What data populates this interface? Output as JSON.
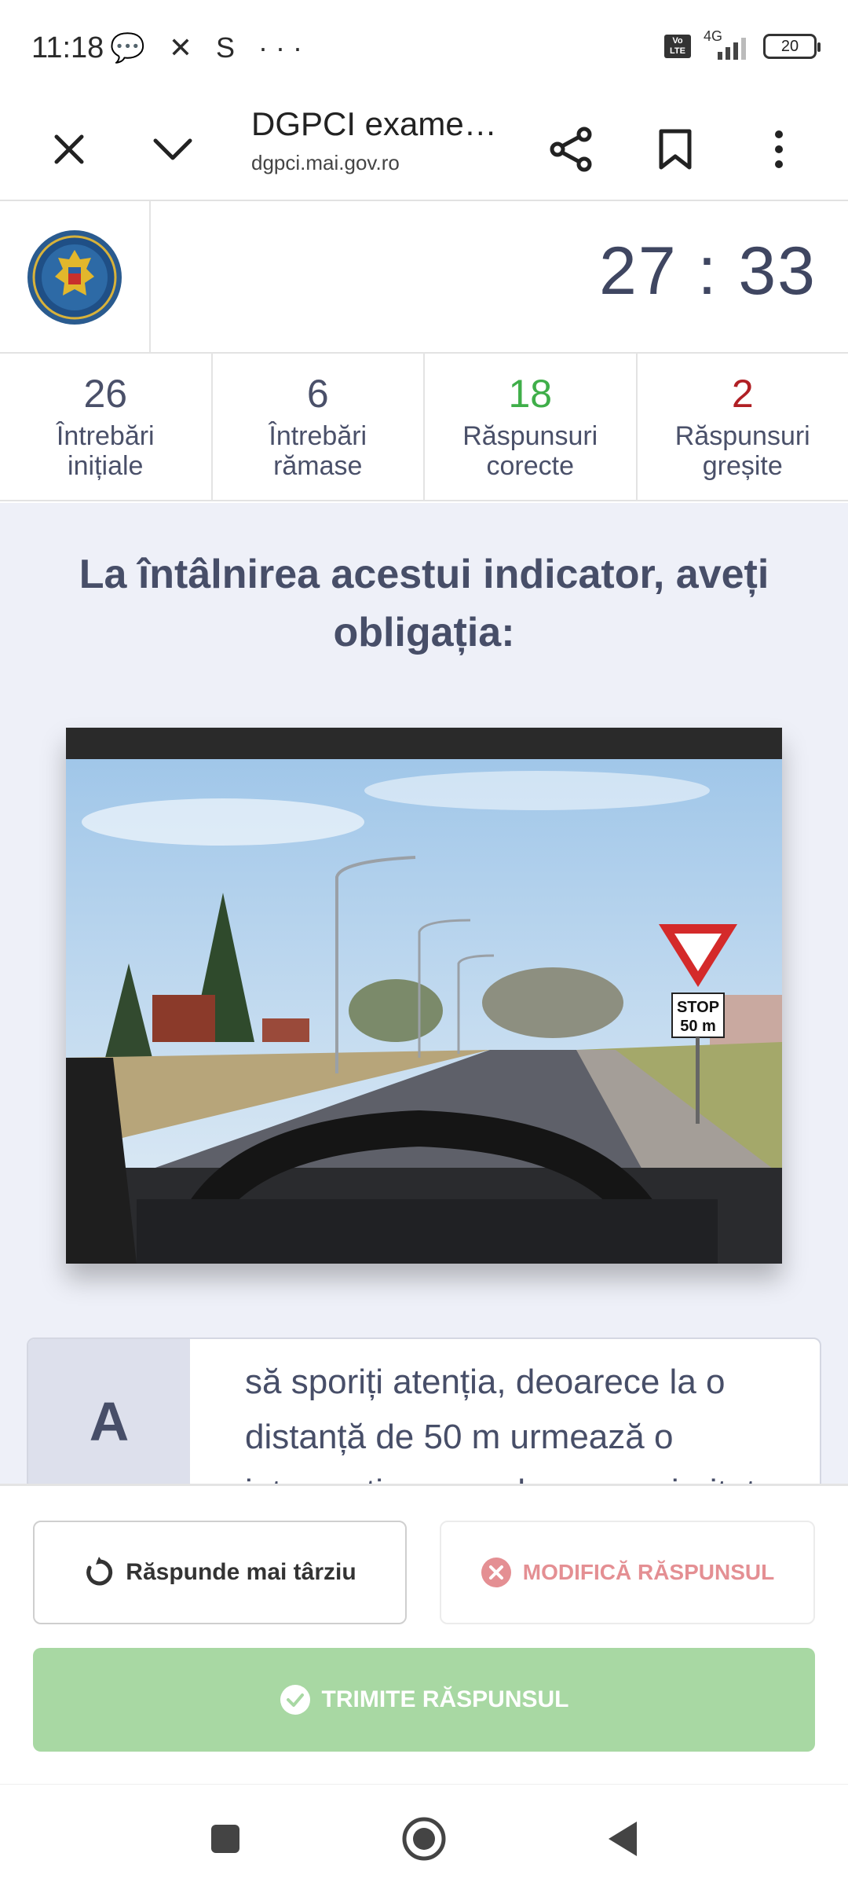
{
  "status_bar": {
    "time": "11:18",
    "left_icons": "💬 ✕ S ···",
    "network_label": "4G",
    "volte": "Vo LTE",
    "battery": "20"
  },
  "browser": {
    "title": "DGPCI exame…",
    "url": "dgpci.mai.gov.ro"
  },
  "header": {
    "timer": "27 : 33"
  },
  "stats": [
    {
      "value": "26",
      "label_line1": "Întrebări",
      "label_line2": "inițiale",
      "color": "#4a5069"
    },
    {
      "value": "6",
      "label_line1": "Întrebări",
      "label_line2": "rămase",
      "color": "#4a5069"
    },
    {
      "value": "18",
      "label_line1": "Răspunsuri",
      "label_line2": "corecte",
      "color": "#3fae49"
    },
    {
      "value": "2",
      "label_line1": "Răspunsuri",
      "label_line2": "greșite",
      "color": "#b01f24"
    }
  ],
  "question": {
    "text": "La întâlnirea acestui indicator, aveți obligația:",
    "sign_text_1": "STOP",
    "sign_text_2": "50 m"
  },
  "answers": [
    {
      "letter": "A",
      "text": "să sporiți atenția, deoarece la o distanță de 50 m urmează o intersecție cu un drum cu prioritate"
    }
  ],
  "actions": {
    "later_label": "Răspunde mai târziu",
    "modify_label": "MODIFICĂ RĂSPUNSUL",
    "submit_label": "TRIMITE RĂSPUNSUL"
  },
  "colors": {
    "submit_bg": "#a8d8a3",
    "modify_text": "#e48f93",
    "question_bg": "#eef0f8"
  }
}
